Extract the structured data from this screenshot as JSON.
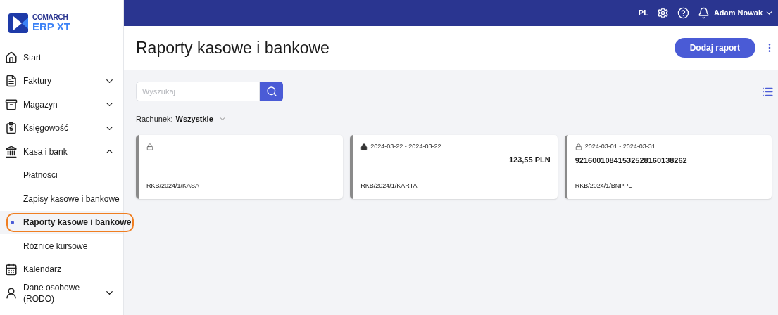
{
  "logo": {
    "brand": "COMARCH",
    "product": "ERP XT"
  },
  "topbar": {
    "language": "PL",
    "user": "Adam Nowak"
  },
  "sidebar": {
    "items": [
      {
        "kind": "home",
        "label": "Start"
      },
      {
        "kind": "invoice",
        "label": "Faktury",
        "expanded": false
      },
      {
        "kind": "warehouse",
        "label": "Magazyn",
        "expanded": false
      },
      {
        "kind": "accounting",
        "label": "Księgowość",
        "expanded": false
      },
      {
        "kind": "bank",
        "label": "Kasa i bank",
        "expanded": true,
        "children": [
          {
            "label": "Płatności",
            "selected": false
          },
          {
            "label": "Zapisy kasowe i bankowe",
            "selected": false
          },
          {
            "label": "Raporty kasowe i bankowe",
            "selected": true
          },
          {
            "label": "Różnice kursowe",
            "selected": false
          }
        ]
      },
      {
        "kind": "calendar",
        "label": "Kalendarz"
      },
      {
        "kind": "person",
        "label": "Dane osobowe (RODO)",
        "expanded": false
      }
    ]
  },
  "page": {
    "title": "Raporty kasowe i bankowe",
    "add_button": "Dodaj raport"
  },
  "search": {
    "placeholder": "Wyszukaj"
  },
  "filter": {
    "label": "Rachunek:",
    "value": "Wszystkie"
  },
  "cards": [
    {
      "locked": false,
      "code": "RKB/2024/1/KASA"
    },
    {
      "locked": true,
      "period": "2024-03-22 - 2024-03-22",
      "amount": "123,55 PLN",
      "code": "RKB/2024/1/KARTA"
    },
    {
      "locked": false,
      "period": "2024-03-01 - 2024-03-31",
      "account": "92160010841532528160138262",
      "code": "RKB/2024/1/BNPPL"
    }
  ]
}
